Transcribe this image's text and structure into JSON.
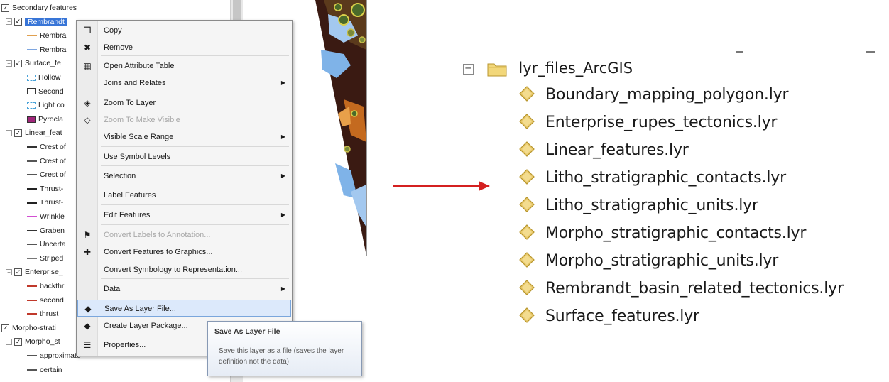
{
  "toc": {
    "layers": [
      {
        "label": "Secondary features",
        "type": "group"
      },
      {
        "label": "Rembrandt",
        "type": "selected-layer"
      },
      {
        "label": "Rembra",
        "type": "sym",
        "color": "#e0a050"
      },
      {
        "label": "Rembra",
        "type": "sym",
        "color": "#7ea6e0"
      },
      {
        "label": "Surface_fe",
        "type": "layer"
      },
      {
        "label": "Hollow",
        "type": "sym-dots"
      },
      {
        "label": "Second",
        "type": "sym-box"
      },
      {
        "label": "Light co",
        "type": "sym-dots"
      },
      {
        "label": "Pyrocla",
        "type": "sym-fill"
      },
      {
        "label": "Linear_feat",
        "type": "layer"
      },
      {
        "label": "Crest of",
        "type": "sym",
        "color": "#333333"
      },
      {
        "label": "Crest of",
        "type": "sym",
        "color": "#555555"
      },
      {
        "label": "Crest of",
        "type": "sym",
        "color": "#555555"
      },
      {
        "label": "Thrust-",
        "type": "sym",
        "color": "#222222"
      },
      {
        "label": "Thrust-",
        "type": "sym",
        "color": "#222222"
      },
      {
        "label": "Wrinkle",
        "type": "sym",
        "color": "#d24fd2"
      },
      {
        "label": "Graben",
        "type": "sym",
        "color": "#333333"
      },
      {
        "label": "Uncerta",
        "type": "sym",
        "color": "#555555"
      },
      {
        "label": "Striped",
        "type": "sym",
        "color": "#777777"
      },
      {
        "label": "Enterprise_",
        "type": "layer"
      },
      {
        "label": "backthr",
        "type": "sym",
        "color": "#c0392b"
      },
      {
        "label": "second",
        "type": "sym",
        "color": "#c0392b"
      },
      {
        "label": "thrust",
        "type": "sym",
        "color": "#c0392b"
      },
      {
        "label": "Morpho-strati",
        "type": "group"
      },
      {
        "label": "Morpho_st",
        "type": "layer"
      },
      {
        "label": "approximate",
        "type": "sym",
        "color": "#555555"
      },
      {
        "label": "certain",
        "type": "sym",
        "color": "#555555"
      }
    ]
  },
  "context_menu": {
    "items": [
      {
        "label": "Copy",
        "icon": "copy-icon",
        "glyph": "❐"
      },
      {
        "label": "Remove",
        "icon": "remove-icon",
        "glyph": "✖"
      },
      {
        "label": "Open Attribute Table",
        "icon": "table-icon",
        "glyph": "▦"
      },
      {
        "label": "Joins and Relates",
        "submenu": true
      },
      {
        "label": "Zoom To Layer",
        "icon": "zoom-layer-icon",
        "glyph": "◈"
      },
      {
        "label": "Zoom To Make Visible",
        "icon": "zoom-visible-icon",
        "glyph": "◇",
        "disabled": true
      },
      {
        "label": "Visible Scale Range",
        "submenu": true
      },
      {
        "label": "Use Symbol Levels"
      },
      {
        "label": "Selection",
        "submenu": true
      },
      {
        "label": "Label Features"
      },
      {
        "label": "Edit Features",
        "submenu": true
      },
      {
        "label": "Convert Labels to Annotation...",
        "icon": "convert-labels-icon",
        "glyph": "⚑",
        "disabled": true
      },
      {
        "label": "Convert Features to Graphics...",
        "icon": "convert-graphics-icon",
        "glyph": "✚"
      },
      {
        "label": "Convert Symbology to Representation..."
      },
      {
        "label": "Data",
        "submenu": true
      },
      {
        "label": "Save As Layer File...",
        "icon": "save-layer-icon",
        "glyph": "◆",
        "highlight": true
      },
      {
        "label": "Create Layer Package...",
        "icon": "layer-package-icon",
        "glyph": "◆"
      },
      {
        "label": "Properties...",
        "icon": "properties-icon",
        "glyph": "☰"
      }
    ]
  },
  "tooltip": {
    "title": "Save As Layer File",
    "description": "Save this layer as a file (saves the layer definition not the data)"
  },
  "file_tree": {
    "folder": "lyr_files_ArcGIS",
    "files": [
      "Boundary_mapping_polygon.lyr",
      "Enterprise_rupes_tectonics.lyr",
      "Linear_features.lyr",
      "Litho_stratigraphic_contacts.lyr",
      "Litho_stratigraphic_units.lyr",
      "Morpho_stratigraphic_contacts.lyr",
      "Morpho_stratigraphic_units.lyr",
      "Rembrandt_basin_related_tectonics.lyr",
      "Surface_features.lyr"
    ]
  },
  "colors": {
    "arrow": "#d42020",
    "selection": "#3875d7",
    "folder": "#f2d77a",
    "lyr_icon": "#e8c86a"
  }
}
